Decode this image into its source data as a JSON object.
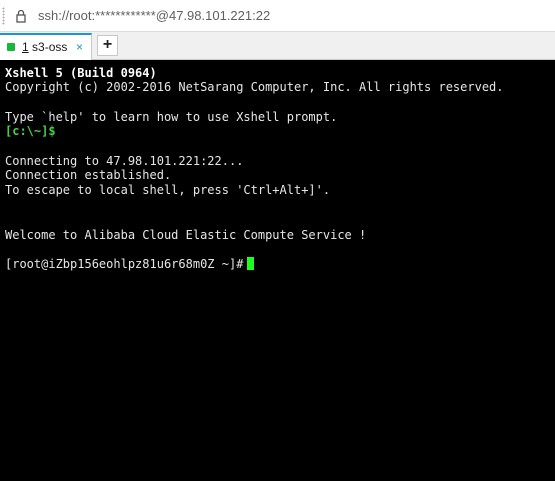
{
  "address_bar": {
    "url": "ssh://root:************@47.98.101.221:22"
  },
  "tabs": [
    {
      "number": "1",
      "label": "s3-oss",
      "close": "×",
      "status": "connected"
    }
  ],
  "new_tab": {
    "label": "+"
  },
  "terminal": {
    "lines": [
      "Xshell 5 (Build 0964)",
      "Copyright (c) 2002-2016 NetSarang Computer, Inc. All rights reserved.",
      "Type `help' to learn how to use Xshell prompt.",
      "[c:\\~]$",
      "Connecting to 47.98.101.221:22...",
      "Connection established.",
      "To escape to local shell, press 'Ctrl+Alt+]'.",
      "Welcome to Alibaba Cloud Elastic Compute Service !",
      "[root@iZbp156eohlpz81u6r68m0Z ~]#"
    ]
  },
  "colors": {
    "terminal_bg": "#000000",
    "terminal_fg": "#e6e6e6",
    "prompt_green": "#3fd13f",
    "cursor_green": "#1cff1c",
    "tab_accent": "#1b95d8",
    "status_green": "#16b83c"
  },
  "icons": {
    "lock": "lock-icon",
    "status": "status-dot-icon",
    "close": "close-icon",
    "new_tab": "plus-icon"
  }
}
